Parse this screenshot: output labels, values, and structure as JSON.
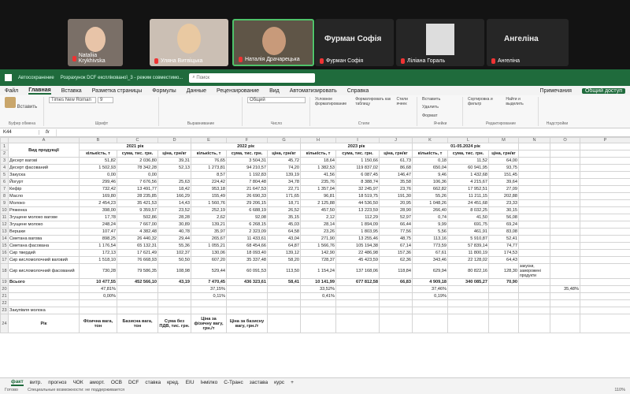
{
  "call": {
    "participants": [
      {
        "name": "Nataliia Krykhivska",
        "bg": "#7a6f67"
      },
      {
        "name": "Уляна Витвіцька",
        "bg": "#cbbfb4"
      },
      {
        "name": "Наталія Драчарецька",
        "bg": "#5f5547"
      },
      {
        "name": "Фурман Софія"
      },
      {
        "name": "Ліліана Гораль",
        "bg": "#ddd"
      },
      {
        "name": "Ангеліна"
      }
    ],
    "big_names": [
      "Фурман Софія",
      "Ангеліна"
    ]
  },
  "excel": {
    "autosave": "Автосохранение",
    "file_name": "Розрахунок DCF експлікованої_3 - режим совместимо...",
    "search_placeholder": "Поиск",
    "tabs": [
      "Файл",
      "Главная",
      "Вставка",
      "Разметка страницы",
      "Формулы",
      "Данные",
      "Рецензирование",
      "Вид",
      "Автоматизировать",
      "Справка"
    ],
    "comments": "Примечания",
    "share": "Общий доступ",
    "ribbon": {
      "paste": "Вставить",
      "clipboard": "Буфер обмена",
      "font_name": "Times New Roman",
      "font_size": "9",
      "font": "Шрифт",
      "align": "Выравнивание",
      "num_format": "Общий",
      "number": "Число",
      "cond": "Условное форматирование",
      "as_table": "Форматировать как таблицу",
      "styles_btn": "Стили ячеек",
      "styles": "Стили",
      "insert": "Вставить",
      "delete": "Удалить",
      "format": "Формат",
      "cells": "Ячейки",
      "sort": "Сортировка и фильтр",
      "find": "Найти и выделить",
      "editing": "Редактирование",
      "addins": "Надстройки"
    },
    "cell_ref": "K44",
    "fx": "fx",
    "cols": [
      "A",
      "B",
      "C",
      "D",
      "E",
      "F",
      "G",
      "H",
      "I",
      "J",
      "K",
      "L",
      "M",
      "N",
      "O",
      "P"
    ],
    "years": [
      "2021 рік",
      "2022 рік",
      "2023 рік",
      "01-05.2024 рік"
    ],
    "col_titles": {
      "product": "Вид продукції",
      "q": "кількість, т",
      "s": "сума, тис. грн.",
      "p": "ціна, грн/кг"
    },
    "rows": [
      [
        "Десерт вагові",
        "51,82",
        "2 036,80",
        "39,31",
        "76,65",
        "3 504,31",
        "45,72",
        "18,64",
        "1 150,66",
        "61,73",
        "0,18",
        "11,52",
        "64,00",
        ""
      ],
      [
        "Десерт фасований",
        "1 502,93",
        "78 342,28",
        "52,13",
        "1 273,81",
        "94 210,57",
        "74,20",
        "1 382,53",
        "119 837,02",
        "86,68",
        "650,04",
        "60 941,95",
        "93,75",
        ""
      ],
      [
        "Закуска",
        "0,00",
        "0,00",
        "",
        "8,57",
        "1 192,83",
        "139,19",
        "41,56",
        "6 087,45",
        "146,47",
        "9,46",
        "1 432,68",
        "151,45",
        ""
      ],
      [
        "Йогурт",
        "299,46",
        "7 676,56",
        "25,63",
        "224,42",
        "7 804,48",
        "34,78",
        "235,76",
        "8 388,74",
        "35,58",
        "106,36",
        "4 215,67",
        "39,64",
        ""
      ],
      [
        "Кефір",
        "732,42",
        "13 491,77",
        "18,42",
        "953,18",
        "21 647,53",
        "22,71",
        "1 357,04",
        "32 245,97",
        "23,76",
        "662,82",
        "17 952,51",
        "27,09",
        ""
      ],
      [
        "Масло",
        "169,80",
        "28 235,85",
        "166,29",
        "155,49",
        "26 690,33",
        "171,65",
        "96,81",
        "18 519,75",
        "191,30",
        "55,26",
        "11 211,15",
        "202,88",
        ""
      ],
      [
        "Молоко",
        "2 454,23",
        "35 421,53",
        "14,43",
        "1 560,76",
        "29 206,15",
        "18,71",
        "2 125,88",
        "44 536,50",
        "20,95",
        "1 048,26",
        "24 451,68",
        "23,33",
        ""
      ],
      [
        "Ряженка",
        "398,00",
        "9 359,57",
        "23,52",
        "252,19",
        "6 688,19",
        "26,52",
        "457,50",
        "13 223,59",
        "28,90",
        "266,40",
        "8 032,25",
        "30,15",
        ""
      ],
      [
        "Згущене молоко вагове",
        "17,78",
        "502,86",
        "28,28",
        "2,62",
        "92,08",
        "35,15",
        "2,12",
        "112,29",
        "52,97",
        "0,74",
        "41,50",
        "56,08",
        ""
      ],
      [
        "Згущене молоко",
        "248,24",
        "7 667,00",
        "30,89",
        "139,21",
        "6 268,15",
        "45,03",
        "28,14",
        "1 894,09",
        "66,44",
        "9,99",
        "691,75",
        "69,24",
        ""
      ],
      [
        "Вершки",
        "107,47",
        "4 382,48",
        "40,78",
        "35,97",
        "2 323,09",
        "64,58",
        "23,26",
        "1 803,95",
        "77,56",
        "5,56",
        "461,91",
        "83,08",
        ""
      ],
      [
        "Сметана вагова",
        "898,25",
        "26 440,32",
        "29,44",
        "265,67",
        "11 433,61",
        "43,04",
        "271,90",
        "13 255,46",
        "48,75",
        "113,16",
        "5 910,87",
        "52,41",
        ""
      ],
      [
        "Сметана фасована",
        "1 176,54",
        "65 132,31",
        "55,36",
        "1 055,21",
        "68 454,66",
        "64,87",
        "1 566,76",
        "105 194,38",
        "67,14",
        "773,59",
        "57 839,14",
        "74,77",
        ""
      ],
      [
        "Сир твердий",
        "172,13",
        "17 621,49",
        "102,37",
        "130,06",
        "18 093,40",
        "139,12",
        "142,90",
        "22 486,98",
        "157,36",
        "67,61",
        "11 800,19",
        "174,53",
        ""
      ],
      [
        "Сир кисломолочний ваговий",
        "1 518,10",
        "76 668,93",
        "50,50",
        "607,20",
        "35 337,48",
        "58,20",
        "728,37",
        "45 423,59",
        "62,36",
        "343,46",
        "22 128,02",
        "64,43",
        ""
      ],
      [
        "Сир кисломолочний фасований",
        "730,28",
        "79 586,35",
        "108,98",
        "529,44",
        "60 091,53",
        "113,50",
        "1 154,24",
        "137 168,06",
        "118,84",
        "629,94",
        "80 822,16",
        "128,30",
        "закуски, заморожені продукти"
      ]
    ],
    "total": [
      "Всього",
      "10 477,55",
      "452 566,10",
      "43,19",
      "7 470,45",
      "436 323,61",
      "58,41",
      "10 141,99",
      "677 812,58",
      "66,83",
      "4 909,18",
      "340 085,27",
      "70,90"
    ],
    "row20": [
      "",
      "47,81%",
      "",
      "",
      "37,15%",
      "",
      "",
      "33,52%",
      "",
      "",
      "37,46%",
      "",
      "",
      "",
      "35,48%"
    ],
    "row21": [
      "",
      "0,00%",
      "",
      "",
      "0,11%",
      "",
      "",
      "0,41%",
      "",
      "",
      "0,19%"
    ],
    "r23": "Закупівля молока",
    "r24": [
      "Рік",
      "Фізична вага, тон",
      "Базисна вага, тон",
      "Сума без ПДВ, тис. грн.",
      "Ціна за фізичну вагу, грн./т",
      "Ціна за базисну вагу, грн./т"
    ],
    "sheets": [
      "факт",
      "витр.",
      "прогноз",
      "ЧОК",
      "аморт.",
      "ОСВ",
      "DCF",
      "ставка",
      "кред.",
      "EIU",
      "Інмілко",
      "С-Транс",
      "застава",
      "курс"
    ],
    "status": {
      "ready": "Готово",
      "access": "Специальные возможности: не поддерживается",
      "zoom": "110%"
    }
  }
}
